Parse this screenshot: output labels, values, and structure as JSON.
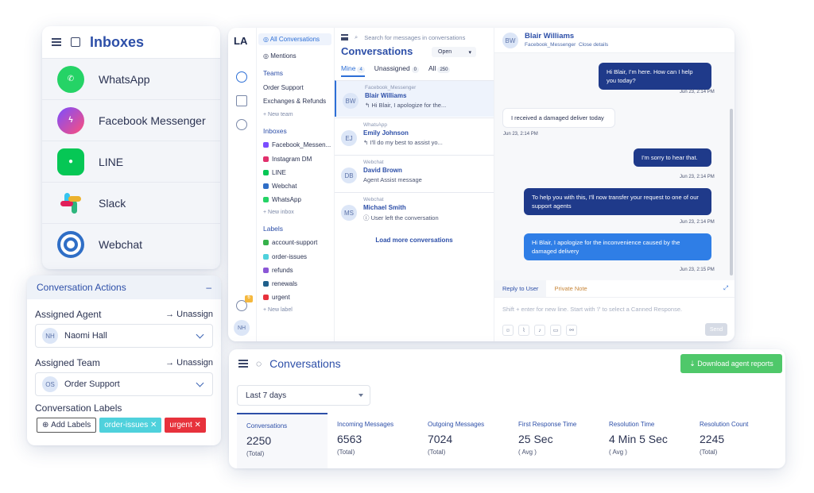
{
  "inboxes": {
    "title": "Inboxes",
    "items": [
      {
        "label": "WhatsApp",
        "icon": "whatsapp-icon"
      },
      {
        "label": "Facebook Messenger",
        "icon": "messenger-icon"
      },
      {
        "label": "LINE",
        "icon": "line-icon"
      },
      {
        "label": "Slack",
        "icon": "slack-icon"
      },
      {
        "label": "Webchat",
        "icon": "webchat-icon"
      }
    ]
  },
  "actions": {
    "title": "Conversation Actions",
    "assigned_agent_label": "Assigned Agent",
    "unassign": "Unassign",
    "agent_initials": "NH",
    "agent_name": "Naomi Hall",
    "assigned_team_label": "Assigned Team",
    "team_initials": "OS",
    "team_name": "Order Support",
    "labels_title": "Conversation Labels",
    "add_labels": "Add Labels",
    "labels": [
      "order-issues",
      "urgent"
    ]
  },
  "brand": "LA",
  "sidebar": {
    "all_conversations": "All Conversations",
    "mentions": "Mentions",
    "teams_head": "Teams",
    "teams": [
      "Order Support",
      "Exchanges & Refunds"
    ],
    "new_team": "+ New team",
    "inboxes_head": "Inboxes",
    "inboxes": [
      {
        "label": "Facebook_Messen...",
        "color": "#7b4dff"
      },
      {
        "label": "Instagram DM",
        "color": "#e1306c"
      },
      {
        "label": "LINE",
        "color": "#06c755"
      },
      {
        "label": "Webchat",
        "color": "#2f6ec6"
      },
      {
        "label": "WhatsApp",
        "color": "#25d366"
      }
    ],
    "new_inbox": "+ New inbox",
    "labels_head": "Labels",
    "labels": [
      {
        "label": "account-support",
        "color": "#36b14a"
      },
      {
        "label": "order-issues",
        "color": "#4fd1dc"
      },
      {
        "label": "refunds",
        "color": "#8b57d6"
      },
      {
        "label": "renewals",
        "color": "#1f5f8b"
      },
      {
        "label": "urgent",
        "color": "#e7323c"
      }
    ],
    "new_label": "+ New label",
    "notif_count": "6",
    "user_initials": "NH"
  },
  "convlist": {
    "search_placeholder": "Search for messages in conversations",
    "title": "Conversations",
    "status": "Open",
    "tabs": [
      {
        "label": "Mine",
        "count": "4"
      },
      {
        "label": "Unassigned",
        "count": "0"
      },
      {
        "label": "All",
        "count": "250"
      }
    ],
    "items": [
      {
        "initials": "BW",
        "channel": "Facebook_Messenger",
        "name": "Blair Williams",
        "preview": "↰ Hi Blair, I apologize for the..."
      },
      {
        "initials": "EJ",
        "channel": "WhatsApp",
        "name": "Emily Johnson",
        "preview": "↰ I'll do my best to assist yo..."
      },
      {
        "initials": "DB",
        "channel": "Webchat",
        "name": "David Brown",
        "preview": "Agent Assist message"
      },
      {
        "initials": "MS",
        "channel": "Webchat",
        "name": "Michael Smith",
        "preview": "ⓘ User left the conversation"
      }
    ],
    "load_more": "Load more conversations"
  },
  "chat": {
    "initials": "BW",
    "name": "Blair Williams",
    "channel": "Facebook_Messenger",
    "close_details": "Close details",
    "messages": [
      {
        "text": "Hi Blair, I'm here. How can I help you today?",
        "time": "Jun 23, 2:14 PM"
      },
      {
        "text": "I received a damaged deliver today",
        "time": "Jun 23, 2:14 PM"
      },
      {
        "text": "I'm sorry to hear that.",
        "time": "Jun 23, 2:14 PM"
      },
      {
        "text": "To help you with this, I'll now transfer your request to one of our support agents",
        "time": "Jun 23, 2:14 PM"
      },
      {
        "text": "Hi Blair, I apologize for the inconvenience caused by the damaged delivery",
        "time": "Jun 23, 2:15 PM"
      }
    ],
    "reply_tab": "Reply to User",
    "note_tab": "Private Note",
    "composer_placeholder": "Shift + enter for new line. Start with '/' to select a Canned Response.",
    "send": "Send"
  },
  "reports": {
    "title": "Conversations",
    "download": "⇣  Download agent reports",
    "range": "Last 7 days",
    "metrics": [
      {
        "label": "Conversations",
        "value": "2250",
        "unit": "(Total)"
      },
      {
        "label": "Incoming Messages",
        "value": "6563",
        "unit": "(Total)"
      },
      {
        "label": "Outgoing Messages",
        "value": "7024",
        "unit": "(Total)"
      },
      {
        "label": "First Response Time",
        "value": "25 Sec",
        "unit": "( Avg )"
      },
      {
        "label": "Resolution Time",
        "value": "4 Min 5 Sec",
        "unit": "( Avg )"
      },
      {
        "label": "Resolution Count",
        "value": "2245",
        "unit": "(Total)"
      }
    ]
  }
}
